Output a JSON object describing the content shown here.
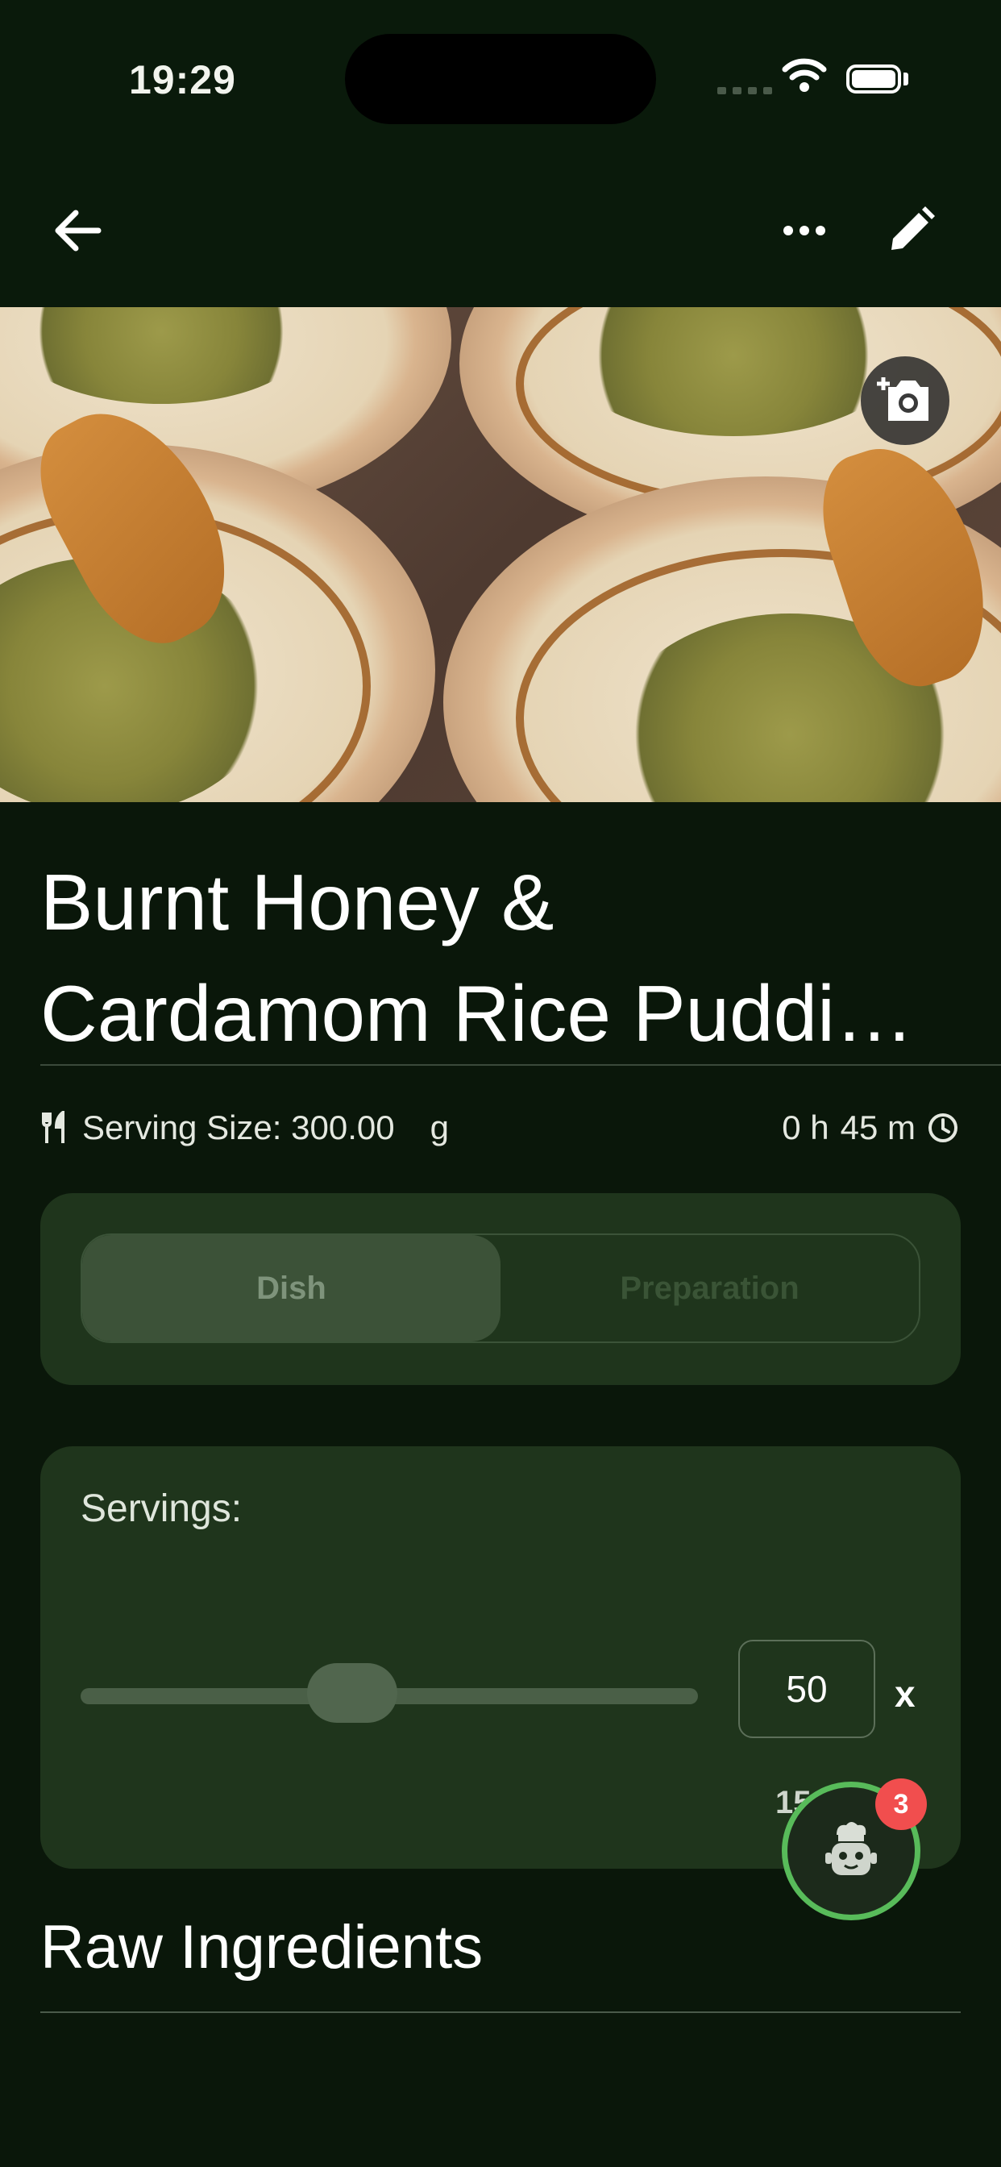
{
  "status_bar": {
    "time": "19:29"
  },
  "recipe": {
    "title_line1": "Burnt Honey &",
    "title_line2": "Cardamom Rice Puddi…",
    "serving_size_label": "Serving Size: 300.00",
    "serving_unit": "g",
    "time_hours": "0 h",
    "time_minutes": "45 m"
  },
  "tabs": [
    {
      "label": "Dish",
      "active": true
    },
    {
      "label": "Preparation",
      "active": false
    }
  ],
  "servings": {
    "label": "Servings:",
    "value": "50",
    "multiplier_symbol": "x",
    "slider_fraction": 0.44,
    "partial_text": "15"
  },
  "assistant": {
    "badge_count": "3"
  },
  "sections": {
    "raw_ingredients": "Raw Ingredients"
  },
  "icons": [
    "back-arrow-icon",
    "more-icon",
    "edit-pencil-icon",
    "add-photo-icon",
    "utensils-icon",
    "clock-icon",
    "chef-robot-icon",
    "wifi-icon",
    "battery-icon"
  ],
  "colors": {
    "background": "#0a170a",
    "card": "#1f351c",
    "accent_ring": "#58bb5a",
    "badge": "#f14e4e"
  }
}
